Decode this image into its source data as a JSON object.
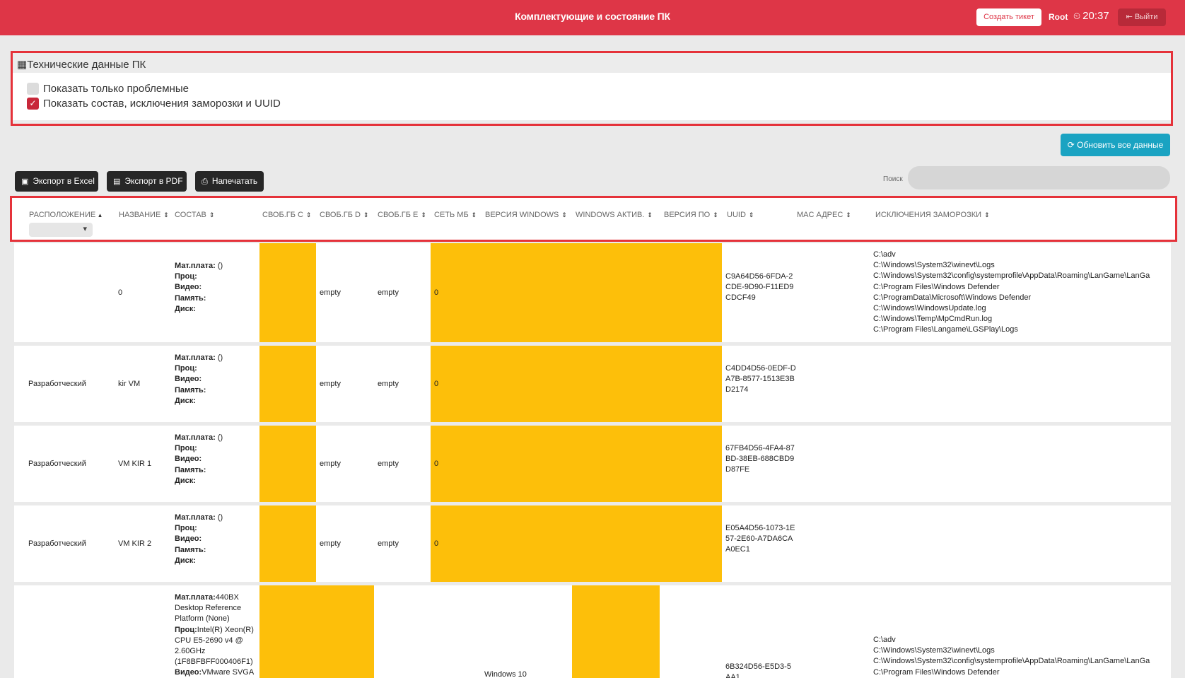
{
  "header": {
    "title": "Комплектующие и состояние ПК",
    "create_ticket": "Создать тикет",
    "user": "Root",
    "time": "20:37",
    "logout": "Выйти"
  },
  "panel": {
    "title": "Технические данные ПК",
    "opt_problem": "Показать только проблемные",
    "opt_composition": "Показать состав, исключения заморозки и UUID"
  },
  "toolbar": {
    "refresh": "Обновить все данные",
    "export_excel": "Экспорт в Excel",
    "export_pdf": "Экспорт в PDF",
    "print": "Напечатать",
    "search_label": "Поиск"
  },
  "columns": [
    "РАСПОЛОЖЕНИЕ",
    "НАЗВАНИЕ",
    "СОСТАВ",
    "СВОБ.ГБ C",
    "СВОБ.ГБ D",
    "СВОБ.ГБ E",
    "СЕТЬ МБ",
    "ВЕРСИЯ WINDOWS",
    "WINDOWS АКТИВ.",
    "ВЕРСИЯ ПО",
    "UUID",
    "MAC АДРЕС",
    "ИСКЛЮЧЕНИЯ ЗАМОРОЗКИ"
  ],
  "labels": {
    "mb": "Мат.плата:",
    "cpu": "Проц:",
    "gpu": "Видео:",
    "ram": "Память:",
    "disk": "Диск:"
  },
  "rows": [
    {
      "location": "",
      "name": "0",
      "mb_val": " ()",
      "free_d": "empty",
      "free_e": "empty",
      "net": "0",
      "uuid": "C9A64D56-6FDA-2CDE-9D90-F11ED9CDCF49",
      "exclusions": [
        "C:\\adv",
        "C:\\Windows\\System32\\winevt\\Logs",
        "C:\\Windows\\System32\\config\\systemprofile\\AppData\\Roaming\\LanGame\\LanGa",
        "C:\\Program Files\\Windows Defender",
        "C:\\ProgramData\\Microsoft\\Windows Defender",
        "C:\\Windows\\WindowsUpdate.log",
        "C:\\Windows\\Temp\\MpCmdRun.log",
        "C:\\Program Files\\Langame\\LGSPlay\\Logs"
      ]
    },
    {
      "location": "Разработческий",
      "name": "kir VM",
      "mb_val": " ()",
      "free_d": "empty",
      "free_e": "empty",
      "net": "0",
      "uuid": "C4DD4D56-0EDF-DA7B-8577-1513E3BD2174",
      "exclusions": []
    },
    {
      "location": "Разработческий",
      "name": "VM KIR 1",
      "mb_val": " ()",
      "free_d": "empty",
      "free_e": "empty",
      "net": "0",
      "uuid": "67FB4D56-4FA4-87BD-38EB-688CBD9D87FE",
      "exclusions": []
    },
    {
      "location": "Разработческий",
      "name": "VM KIR 2",
      "mb_val": " ()",
      "free_d": "empty",
      "free_e": "empty",
      "net": "0",
      "uuid": "E05A4D56-1073-1E57-2E60-A7DA6CAA0EC1",
      "exclusions": []
    },
    {
      "mb_text": "440BX Desktop Reference Platform (None)",
      "cpu_text": "Intel(R) Xeon(R) CPU E5-2690 v4 @ 2.60GHz (1F8BFBFF000406F1)",
      "gpu_text": "VMware SVGA",
      "windows": "Windows 10",
      "uuid": "6B324D56-E5D3-5AA1",
      "exclusions": [
        "C:\\adv",
        "C:\\Windows\\System32\\winevt\\Logs",
        "C:\\Windows\\System32\\config\\systemprofile\\AppData\\Roaming\\LanGame\\LanGa",
        "C:\\Program Files\\Windows Defender"
      ]
    }
  ],
  "colors": {
    "header_bg": "#de3647",
    "highlight": "#fdbf0a",
    "refresh_bg": "#1aa3c2"
  }
}
